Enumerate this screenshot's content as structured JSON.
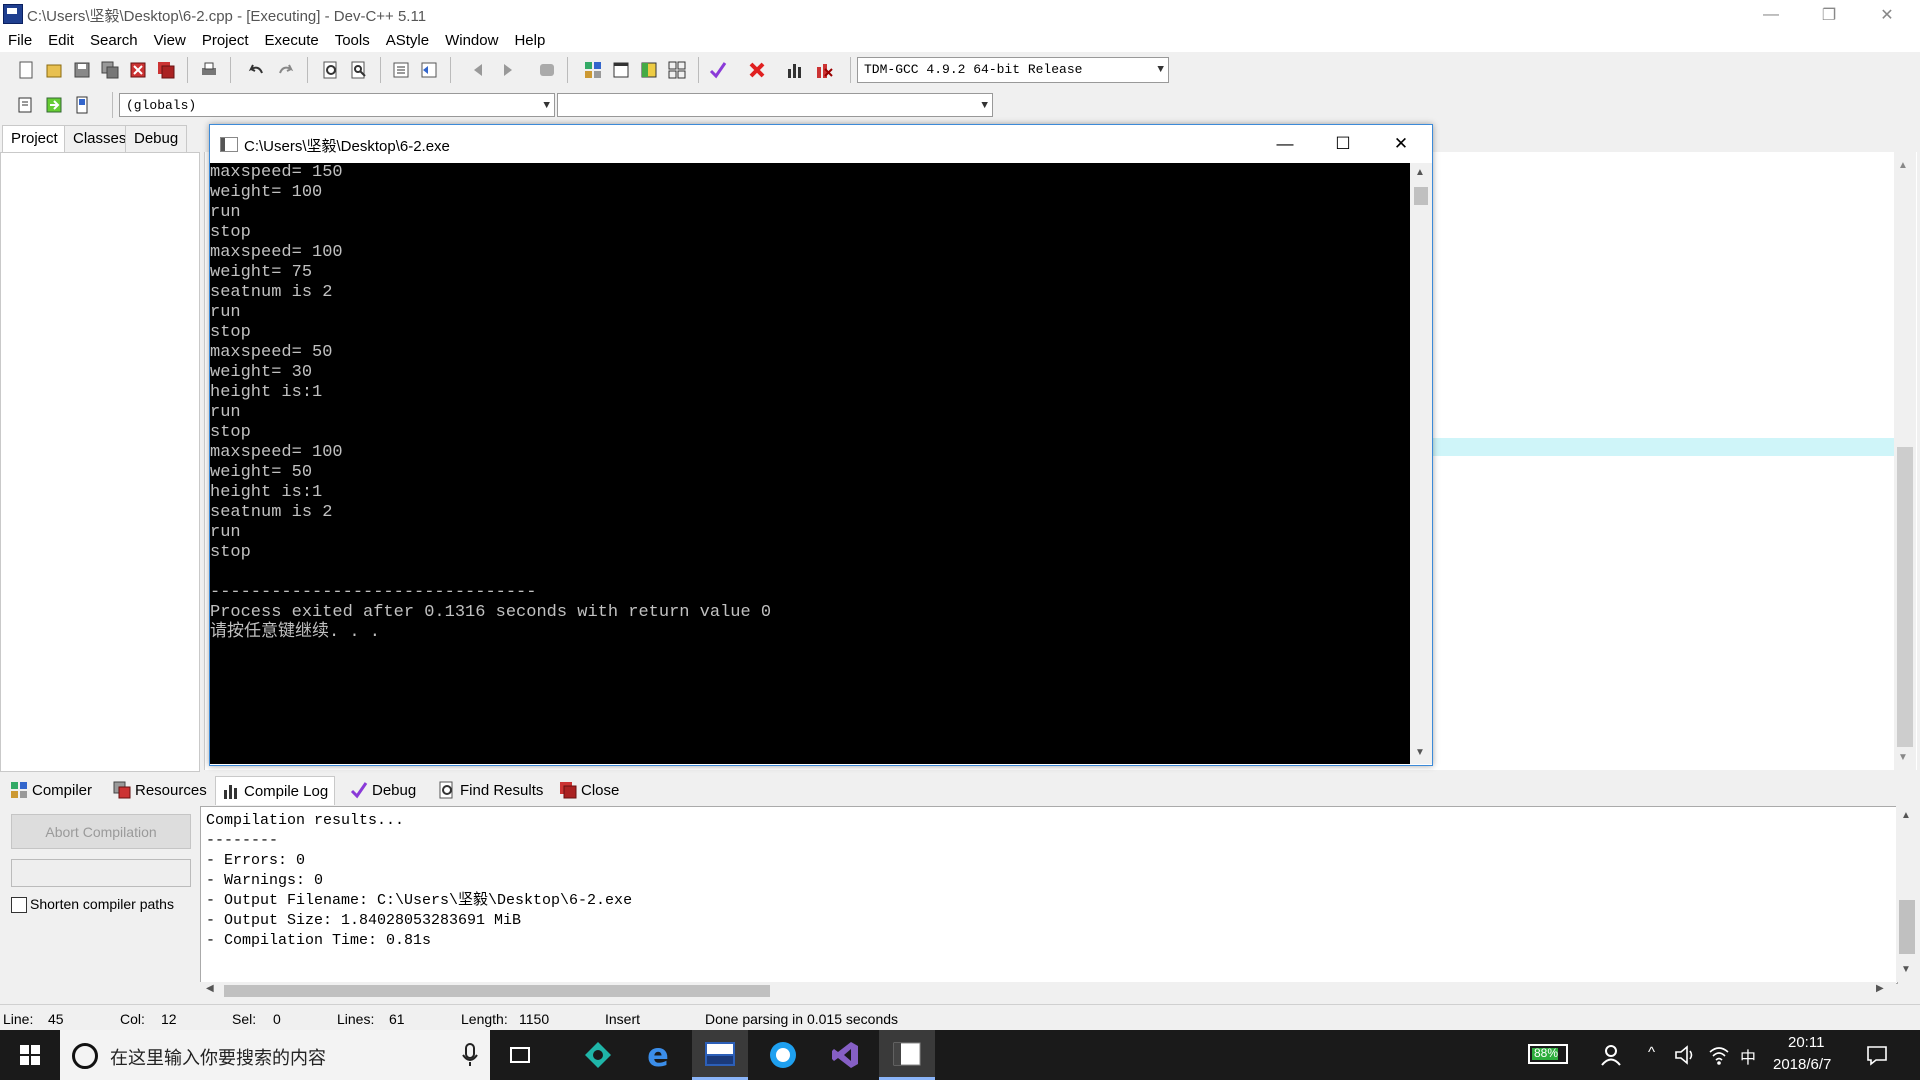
{
  "window": {
    "title": "C:\\Users\\坚毅\\Desktop\\6-2.cpp - [Executing] - Dev-C++ 5.11",
    "minimize": "—",
    "restore": "❐",
    "close": "✕"
  },
  "menu": [
    "File",
    "Edit",
    "Search",
    "View",
    "Project",
    "Execute",
    "Tools",
    "AStyle",
    "Window",
    "Help"
  ],
  "toolbar": {
    "compiler_select": "TDM-GCC 4.9.2 64-bit Release",
    "scope_select": "(globals)",
    "function_select": ""
  },
  "left_tabs": [
    "Project",
    "Classes",
    "Debug"
  ],
  "console": {
    "title": "C:\\Users\\坚毅\\Desktop\\6-2.exe",
    "minimize": "—",
    "maximize": "☐",
    "close": "✕",
    "lines": [
      "maxspeed= 150",
      "weight= 100",
      "run",
      "stop",
      "maxspeed= 100",
      "weight= 75",
      "seatnum is 2",
      "run",
      "stop",
      "maxspeed= 50",
      "weight= 30",
      "height is:1",
      "run",
      "stop",
      "maxspeed= 100",
      "weight= 50",
      "height is:1",
      "seatnum is 2",
      "run",
      "stop",
      "",
      "--------------------------------",
      "Process exited after 0.1316 seconds with return value 0",
      "请按任意键继续. . ."
    ]
  },
  "bottom_tabs": [
    "Compiler",
    "Resources",
    "Compile Log",
    "Debug",
    "Find Results",
    "Close"
  ],
  "compile": {
    "abort_label": "Abort Compilation",
    "shorten_label": "Shorten compiler paths",
    "log_lines": [
      "Compilation results...",
      "--------",
      "- Errors: 0",
      "- Warnings: 0",
      "- Output Filename: C:\\Users\\坚毅\\Desktop\\6-2.exe",
      "- Output Size: 1.84028053283691 MiB",
      "- Compilation Time: 0.81s"
    ]
  },
  "status": {
    "line_label": "Line:",
    "line": "45",
    "col_label": "Col:",
    "col": "12",
    "sel_label": "Sel:",
    "sel": "0",
    "lines_label": "Lines:",
    "lines": "61",
    "length_label": "Length:",
    "length": "1150",
    "mode": "Insert",
    "message": "Done parsing in 0.015 seconds"
  },
  "taskbar": {
    "search_placeholder": "在这里输入你要搜索的内容",
    "battery": "88%",
    "ime": "中",
    "time": "20:11",
    "date": "2018/6/7"
  }
}
